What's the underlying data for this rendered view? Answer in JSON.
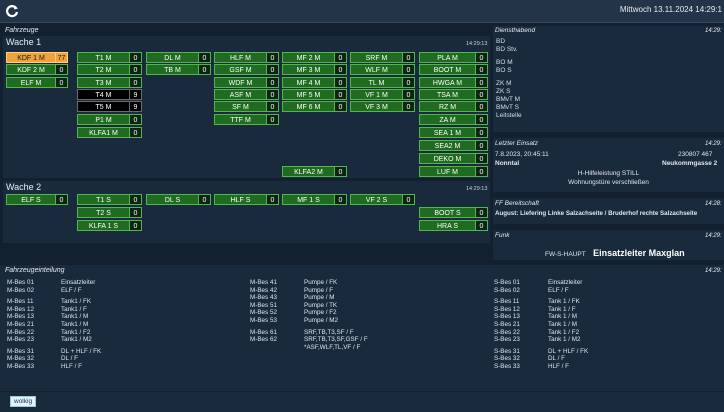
{
  "header": {
    "datetime": "Mittwoch 13.11.2024 14:29:1",
    "logo_icon": "refresh-logo-icon"
  },
  "fahrzeuge": {
    "title": "Fahrzeuge"
  },
  "wache1": {
    "title": "Wache 1",
    "time": "14:29:13",
    "vehicles": [
      {
        "name": "KDF 1 M",
        "count": "77",
        "style": "orange"
      },
      {
        "name": "KDF 2 M",
        "count": "0",
        "style": "green"
      },
      {
        "name": "ELF M",
        "count": "0",
        "style": "green"
      },
      {
        "name": "T1 M",
        "count": "0",
        "style": "green"
      },
      {
        "name": "T2 M",
        "count": "0",
        "style": "green"
      },
      {
        "name": "T3 M",
        "count": "0",
        "style": "green"
      },
      {
        "name": "T4 M",
        "count": "9",
        "style": "black"
      },
      {
        "name": "T5 M",
        "count": "9",
        "style": "black"
      },
      {
        "name": "P1 M",
        "count": "0",
        "style": "green"
      },
      {
        "name": "KLFA1 M",
        "count": "0",
        "style": "green"
      },
      {
        "name": "DL M",
        "count": "0",
        "style": "green"
      },
      {
        "name": "TB M",
        "count": "0",
        "style": "green"
      },
      {
        "name": "HLF M",
        "count": "0",
        "style": "green"
      },
      {
        "name": "GSF M",
        "count": "0",
        "style": "green"
      },
      {
        "name": "WDF M",
        "count": "0",
        "style": "green"
      },
      {
        "name": "ASF M",
        "count": "0",
        "style": "green"
      },
      {
        "name": "SF M",
        "count": "0",
        "style": "green"
      },
      {
        "name": "TTF M",
        "count": "0",
        "style": "green"
      },
      {
        "name": "MF 2 M",
        "count": "0",
        "style": "green"
      },
      {
        "name": "MF 3 M",
        "count": "0",
        "style": "green"
      },
      {
        "name": "MF 4 M",
        "count": "0",
        "style": "green"
      },
      {
        "name": "MF 5 M",
        "count": "0",
        "style": "green"
      },
      {
        "name": "MF 6 M",
        "count": "0",
        "style": "green"
      },
      {
        "name": "SRF M",
        "count": "0",
        "style": "green"
      },
      {
        "name": "WLF M",
        "count": "0",
        "style": "green"
      },
      {
        "name": "TL M",
        "count": "0",
        "style": "green"
      },
      {
        "name": "VF 1 M",
        "count": "0",
        "style": "green"
      },
      {
        "name": "VF 3 M",
        "count": "0",
        "style": "green"
      },
      {
        "name": "PLA M",
        "count": "0",
        "style": "green"
      },
      {
        "name": "BOOT M",
        "count": "0",
        "style": "green"
      },
      {
        "name": "HWGA M",
        "count": "0",
        "style": "green"
      },
      {
        "name": "TSA M",
        "count": "0",
        "style": "green"
      },
      {
        "name": "RZ M",
        "count": "0",
        "style": "green"
      },
      {
        "name": "ZA M",
        "count": "0",
        "style": "green"
      },
      {
        "name": "SEA 1 M",
        "count": "0",
        "style": "green"
      },
      {
        "name": "SEA2 M",
        "count": "0",
        "style": "green"
      },
      {
        "name": "DEKO M",
        "count": "0",
        "style": "green"
      },
      {
        "name": "LUF M",
        "count": "0",
        "style": "green"
      },
      {
        "name": "KLFA2 M",
        "count": "0",
        "style": "green"
      }
    ]
  },
  "wache2": {
    "title": "Wache 2",
    "time": "14:29:13",
    "vehicles": [
      {
        "name": "ELF S",
        "count": "0",
        "style": "green"
      },
      {
        "name": "T1 S",
        "count": "0",
        "style": "green"
      },
      {
        "name": "T2 S",
        "count": "0",
        "style": "green"
      },
      {
        "name": "KLFA 1 S",
        "count": "0",
        "style": "green"
      },
      {
        "name": "DL S",
        "count": "0",
        "style": "green"
      },
      {
        "name": "HLF S",
        "count": "0",
        "style": "green"
      },
      {
        "name": "MF 1 S",
        "count": "0",
        "style": "green"
      },
      {
        "name": "VF 2 S",
        "count": "0",
        "style": "green"
      },
      {
        "name": "BOOT S",
        "count": "0",
        "style": "green"
      },
      {
        "name": "HRA S",
        "count": "0",
        "style": "green"
      }
    ]
  },
  "dienst": {
    "title": "Diensthabend",
    "time": "14:29:",
    "items": [
      "BD",
      "BD Stv.",
      "BO M",
      "BO S",
      "ZK M",
      "ZK S",
      "BMvT M",
      "BMvT S",
      "Leitstelle"
    ]
  },
  "einsatz": {
    "title": "Letzter Einsatz",
    "time": "14:29:",
    "datetime": "7.8.2023, 20:45:11",
    "number": "230807 467",
    "place": "Nonntal",
    "street": "Neukommgasse 2",
    "type": "H-Hilfeleistung STILL",
    "desc": "Wohnungstüre verschließen"
  },
  "bereit": {
    "title": "FF Bereitschaft",
    "time": "14:28:",
    "text": "August: Liefering Linke Salzachseite / Bruderhof rechte Salzachseite"
  },
  "funk": {
    "title": "Funk",
    "time": "14:29:",
    "caller": "FW-S-HAUPT",
    "msg": "Einsatzleiter Maxglan"
  },
  "fzeint": {
    "title": "Fahrzeugeinteilung",
    "time": "14:29:",
    "col1": [
      [
        "M-Bes 01",
        "Einsatzleiter"
      ],
      [
        "M-Bes 02",
        "ELF / F"
      ],
      [
        "",
        ""
      ],
      [
        "M-Bes 11",
        "Tank1 / FK"
      ],
      [
        "M-Bes 12",
        "Tank1 / F"
      ],
      [
        "M-Bes 13",
        "Tank1 / M"
      ],
      [
        "M-Bes 21",
        "Tank1 / M"
      ],
      [
        "M-Bes 22",
        "Tank1 / F2"
      ],
      [
        "M-Bes 23",
        "Tank1 / M2"
      ],
      [
        "",
        ""
      ],
      [
        "M-Bes 31",
        "DL + HLF / FK"
      ],
      [
        "M-Bes 32",
        "DL / F"
      ],
      [
        "M-Bes 33",
        "HLF / F"
      ]
    ],
    "col2": [
      [
        "M-Bes 41",
        "Pumpe / FK"
      ],
      [
        "M-Bes 42",
        "Pumpe / F"
      ],
      [
        "M-Bes 43",
        "Pumpe / M"
      ],
      [
        "M-Bes 51",
        "Pumpe / TK"
      ],
      [
        "M-Bes 52",
        "Pumpe / F2"
      ],
      [
        "M-Bes 53",
        "Pumpe / M2"
      ],
      [
        "",
        ""
      ],
      [
        "M-Bes 61",
        "SRF,TB,T3,SF / F"
      ],
      [
        "M-Bes 62",
        "SRF,TB,T3,SF,GSF / F"
      ],
      [
        "",
        "*ASF,WLF,TL,VF / F"
      ]
    ],
    "col3": [
      [
        "S-Bes 01",
        "Einsatzleiter"
      ],
      [
        "S-Bes 02",
        "ELF / F"
      ],
      [
        "",
        ""
      ],
      [
        "S-Bes 11",
        "Tank 1 / FK"
      ],
      [
        "S-Bes 12",
        "Tank 1 / F"
      ],
      [
        "S-Bes 13",
        "Tank 1 / M"
      ],
      [
        "S-Bes 21",
        "Tank 1 / M"
      ],
      [
        "S-Bes 22",
        "Tank 1 / F2"
      ],
      [
        "S-Bes 23",
        "Tank 1 / M2"
      ],
      [
        "",
        ""
      ],
      [
        "S-Bes 31",
        "DL + HLF / FK"
      ],
      [
        "S-Bes 32",
        "DL / F"
      ],
      [
        "S-Bes 33",
        "HLF / F"
      ]
    ]
  },
  "footer": {
    "weather": "wolkig"
  }
}
